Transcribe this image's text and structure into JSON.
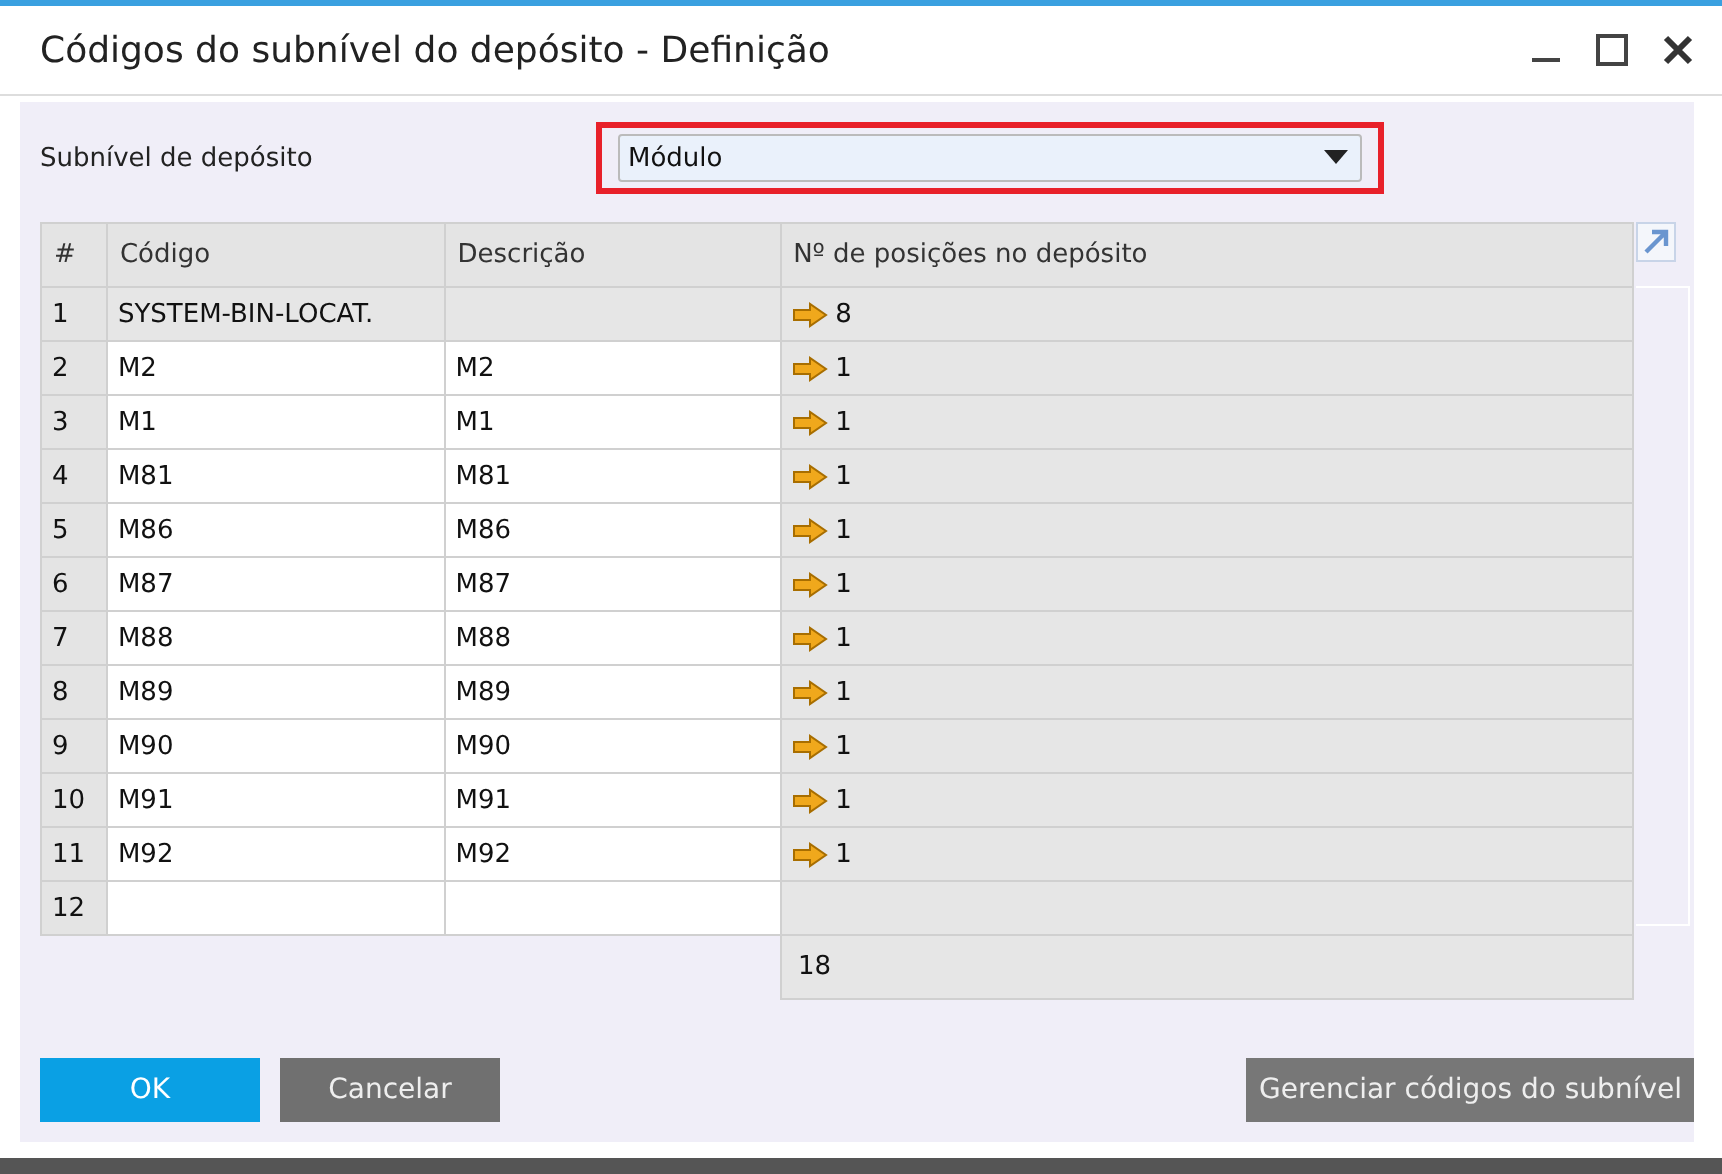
{
  "window": {
    "title": "Códigos do subnível do depósito - Definição"
  },
  "sublevel": {
    "label": "Subnível de depósito",
    "value": "Módulo",
    "highlighted": true
  },
  "table": {
    "columns": [
      "#",
      "Código",
      "Descrição",
      "Nº de posições no depósito"
    ],
    "rows": [
      {
        "num": "1",
        "code": "SYSTEM-BIN-LOCAT.",
        "description": "",
        "positions": "8",
        "editable": false
      },
      {
        "num": "2",
        "code": "M2",
        "description": "M2",
        "positions": "1",
        "editable": true
      },
      {
        "num": "3",
        "code": "M1",
        "description": "M1",
        "positions": "1",
        "editable": true
      },
      {
        "num": "4",
        "code": "M81",
        "description": "M81",
        "positions": "1",
        "editable": true
      },
      {
        "num": "5",
        "code": "M86",
        "description": "M86",
        "positions": "1",
        "editable": true
      },
      {
        "num": "6",
        "code": "M87",
        "description": "M87",
        "positions": "1",
        "editable": true
      },
      {
        "num": "7",
        "code": "M88",
        "description": "M88",
        "positions": "1",
        "editable": true
      },
      {
        "num": "8",
        "code": "M89",
        "description": "M89",
        "positions": "1",
        "editable": true
      },
      {
        "num": "9",
        "code": "M90",
        "description": "M90",
        "positions": "1",
        "editable": true
      },
      {
        "num": "10",
        "code": "M91",
        "description": "M91",
        "positions": "1",
        "editable": true
      },
      {
        "num": "11",
        "code": "M92",
        "description": "M92",
        "positions": "1",
        "editable": true
      },
      {
        "num": "12",
        "code": "",
        "description": "",
        "positions": "",
        "editable": true
      }
    ],
    "total": "18"
  },
  "buttons": [
    {
      "label": "OK",
      "kind": "primary"
    },
    {
      "label": "Cancelar",
      "kind": "secondary"
    }
  ],
  "manage_button": {
    "label": "Gerenciar códigos do subnível"
  }
}
